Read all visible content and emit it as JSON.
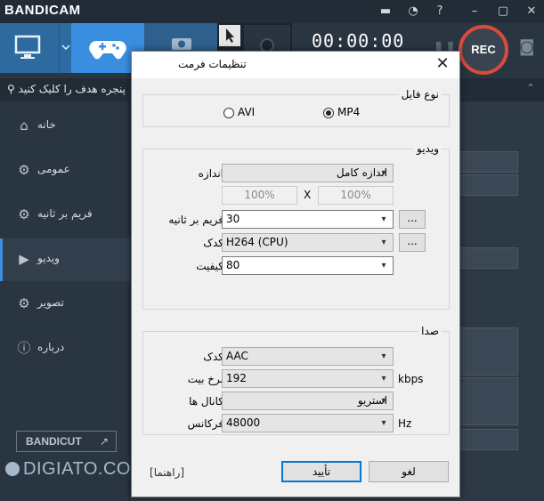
{
  "app": {
    "logo": "BANDICAM",
    "timer": "00:00:00",
    "rec_label": "REC",
    "hint": "پنجره هدف را کلیک کنید",
    "bandicut_label": "BANDICUT",
    "bandicut_arrow": "↗",
    "sidebar": [
      {
        "label": "خانه",
        "icon": "home-icon",
        "glyph": "⌂"
      },
      {
        "label": "عمومی",
        "icon": "gear-icon",
        "glyph": "⚙"
      },
      {
        "label": "فریم بر ثانیه",
        "icon": "fps-icon",
        "glyph": "⚙"
      },
      {
        "label": "ویدیو",
        "icon": "video-settings-icon",
        "glyph": "▶"
      },
      {
        "label": "تصویر",
        "icon": "image-settings-icon",
        "glyph": "⚙"
      },
      {
        "label": "درباره",
        "icon": "info-icon",
        "glyph": "ⓘ"
      }
    ],
    "active_item": "ویدیو",
    "watermark": "DIGIATO.COM"
  },
  "dialog": {
    "title": "تنظیمات فرمت",
    "close_glyph": "✕",
    "file_type": {
      "label": "نوع فایل",
      "options": [
        "AVI",
        "MP4"
      ],
      "selected": "MP4"
    },
    "video": {
      "label": "ویدیو",
      "size_label": "اندازه",
      "size_value": "اندازه کامل",
      "width_pct": "100%",
      "height_pct": "100%",
      "times": "X",
      "fps_label": "فریم بر ثانیه",
      "fps_value": "30",
      "codec_label": "کدک",
      "codec_value": "H264 (CPU)",
      "quality_label": "کیفیت",
      "quality_value": "80",
      "more_label": "..."
    },
    "audio": {
      "label": "صدا",
      "codec_label": "کدک",
      "codec_value": "AAC",
      "bitrate_label": "نرخ بیت",
      "bitrate_value": "192",
      "bitrate_unit": "kbps",
      "channels_label": "کانال ها",
      "channels_value": "استریو",
      "freq_label": "فرکانس",
      "freq_value": "48000",
      "freq_unit": "Hz"
    },
    "help_label": "[راهنما]",
    "ok_label": "تأیید",
    "cancel_label": "لغو"
  }
}
